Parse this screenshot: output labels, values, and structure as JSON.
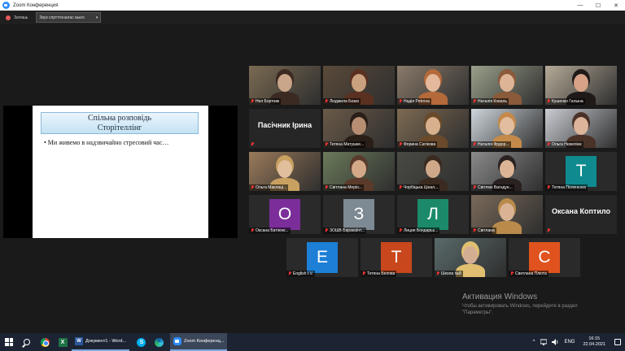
{
  "window": {
    "title": "Zoom Конференция",
    "minimize": "—",
    "maximize": "☐",
    "close": "✕"
  },
  "toolbar": {
    "status": "Затишь",
    "audio_select": "Звук спрттгеналас выкл."
  },
  "slide": {
    "title_line1": "Спільна розповідь",
    "title_line2": "Сторітеллінг",
    "bullet": "• Ми живемо в надзвичайно стресовий час…"
  },
  "participants": [
    {
      "name": "Нел Бортник",
      "type": "video",
      "active": true
    },
    {
      "name": "Людмила Безко",
      "type": "video"
    },
    {
      "name": "Надія Petrova",
      "type": "video"
    },
    {
      "name": "Наталія Коваль",
      "type": "video"
    },
    {
      "name": "Кушенко Галына",
      "type": "video"
    },
    {
      "name": "Пасічник Ірина",
      "type": "name"
    },
    {
      "name": "Тетяна Матушке...",
      "type": "video"
    },
    {
      "name": "Форина Сатікова",
      "type": "video"
    },
    {
      "name": "Наталія Фрдор...",
      "type": "video"
    },
    {
      "name": "Ольга Нєвеліюк",
      "type": "video"
    },
    {
      "name": "Ольга Маклаці...",
      "type": "video"
    },
    {
      "name": "Світлана Меріо...",
      "type": "video"
    },
    {
      "name": "Чорбіцька Цінал...",
      "type": "video"
    },
    {
      "name": "Світлюк Вагндуе...",
      "type": "video"
    },
    {
      "name": "Тетяна Поленєнко",
      "type": "avatar",
      "letter": "T",
      "color": "#0f8a8f"
    },
    {
      "name": "Оксана Батіюнк...",
      "type": "avatar",
      "letter": "O",
      "color": "#7b2e99"
    },
    {
      "name": "ЗОШВ Баракаїнт...",
      "type": "avatar",
      "letter": "З",
      "color": "#7d8a93"
    },
    {
      "name": "Лиция Бондарьє...",
      "type": "avatar",
      "letter": "Л",
      "color": "#1c8a6a"
    },
    {
      "name": "Світлана",
      "type": "video"
    },
    {
      "name": "Оксана Коптило",
      "type": "name"
    },
    {
      "name": "English I.V.",
      "type": "avatar",
      "letter": "E",
      "color": "#1d7fd6"
    },
    {
      "name": "Тетяна Белова",
      "type": "avatar",
      "letter": "T",
      "color": "#c9471c"
    },
    {
      "name": "Школа №8",
      "type": "video"
    },
    {
      "name": "Светлана Плюта",
      "type": "avatar",
      "letter": "C",
      "color": "#e0531e"
    }
  ],
  "watermark": {
    "title": "Активация Windows",
    "text": "Чтобы активировать Windows, перейдите в раздел \"Параметры\"."
  },
  "taskbar": {
    "word_task": "Документ1 - Word...",
    "zoom_task": "Zoom Конференц...",
    "lang": "ENG",
    "time": "16:15",
    "date": "22.04.2021",
    "tray_arrow": "^"
  }
}
